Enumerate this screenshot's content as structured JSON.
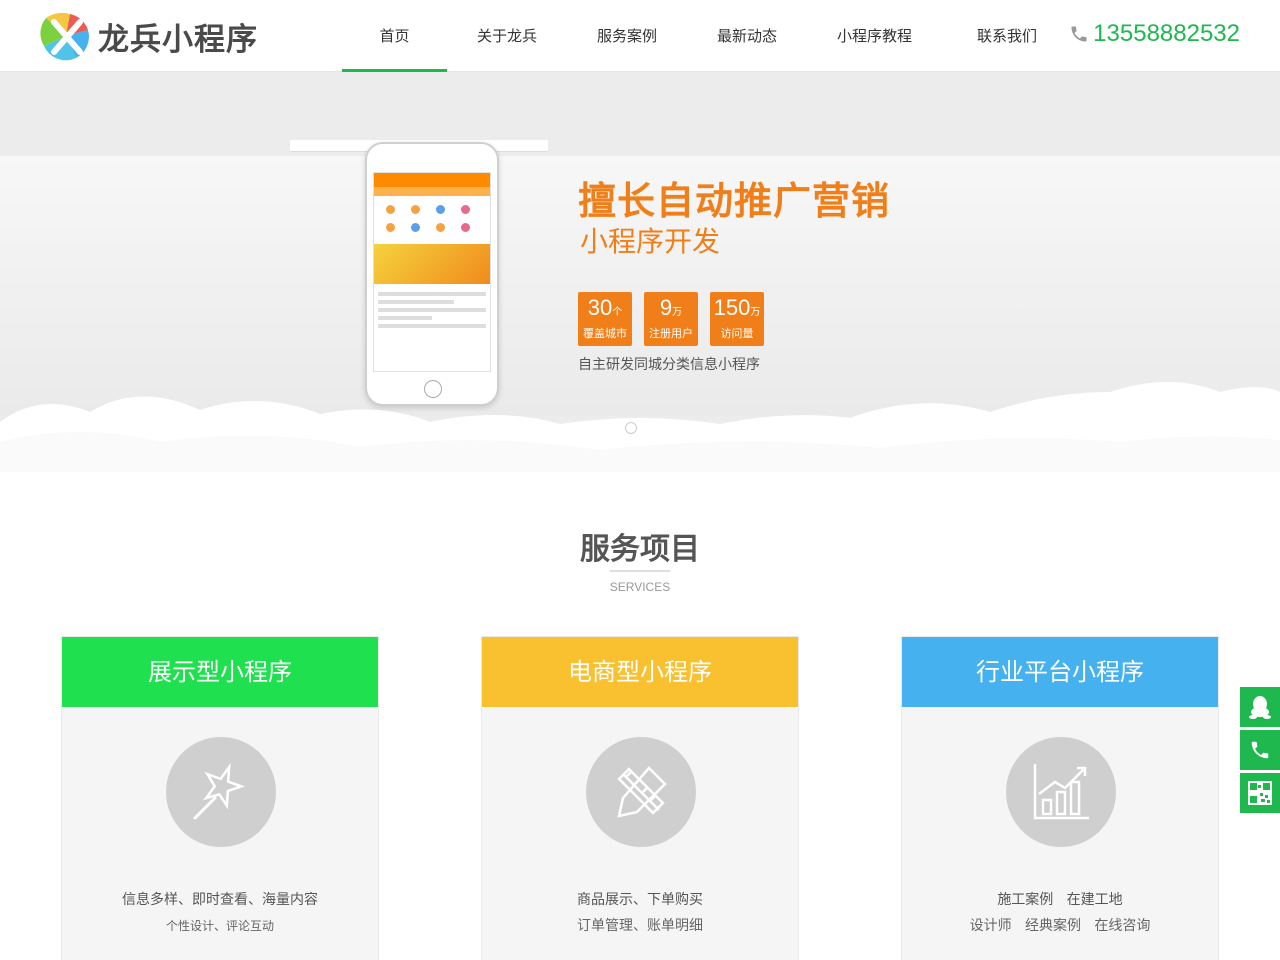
{
  "header": {
    "logo_text": "龙兵小程序",
    "nav": [
      "首页",
      "关于龙兵",
      "服务案例",
      "最新动态",
      "小程序教程",
      "联系我们"
    ],
    "active_index": 0,
    "phone": "13558882532"
  },
  "banner": {
    "title": "擅长自动推广营销",
    "subtitle": "小程序开发",
    "stats": [
      {
        "num": "30",
        "unit": "个",
        "label": "覆盖城市"
      },
      {
        "num": "9",
        "unit": "万",
        "label": "注册用户"
      },
      {
        "num": "150",
        "unit": "万",
        "label": "访问量"
      }
    ],
    "description": "自主研发同城分类信息小程序",
    "slides": 2,
    "active_slide": 1
  },
  "services": {
    "title": "服务项目",
    "subtitle": "SERVICES",
    "cards": [
      {
        "title": "展示型小程序",
        "color": "#1fe14f",
        "line1": "信息多样、即时查看、海量内容",
        "line2": "个性设计、评论互动",
        "icon": "magic-wand-icon"
      },
      {
        "title": "电商型小程序",
        "color": "#f9c02f",
        "line1": "商品展示、下单购买",
        "line2": "订单管理、账单明细",
        "icon": "pencil-ruler-icon"
      },
      {
        "title": "行业平台小程序",
        "color": "#46b1ef",
        "line1": "施工案例   在建工地",
        "line2": "设计师   经典案例   在线咨询",
        "icon": "bar-chart-icon"
      }
    ]
  },
  "colors": {
    "brand_green": "#1eb84f",
    "accent_orange": "#f07f19"
  }
}
